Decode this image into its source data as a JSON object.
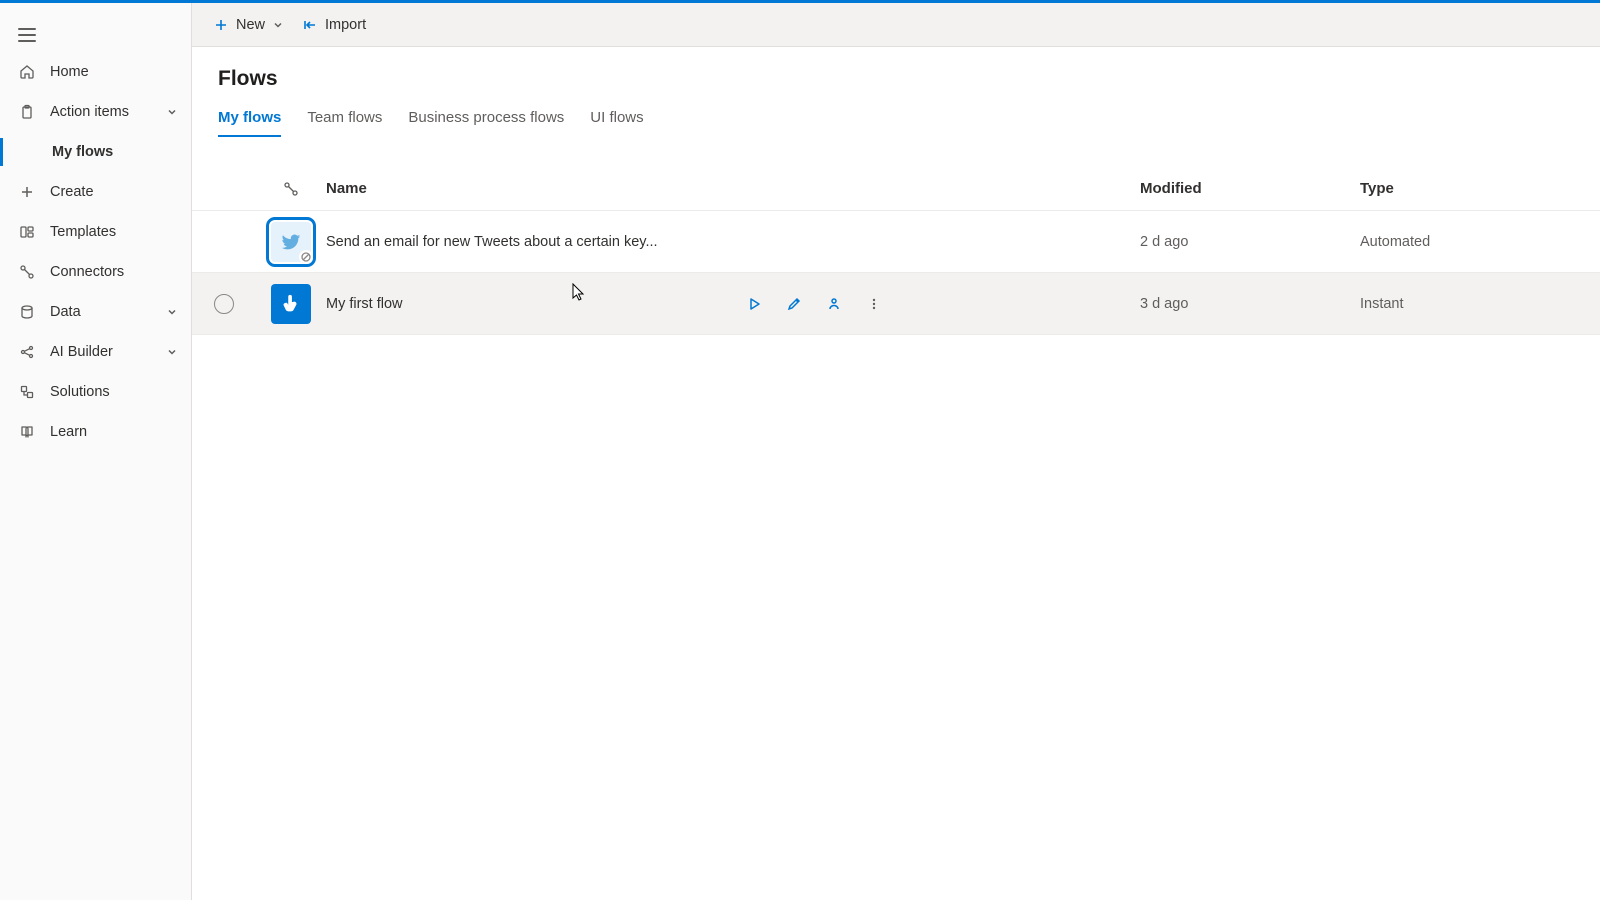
{
  "toolbar": {
    "new_label": "New",
    "import_label": "Import"
  },
  "sidebar": {
    "items": [
      {
        "label": "Home"
      },
      {
        "label": "Action items"
      },
      {
        "label": "My flows"
      },
      {
        "label": "Create"
      },
      {
        "label": "Templates"
      },
      {
        "label": "Connectors"
      },
      {
        "label": "Data"
      },
      {
        "label": "AI Builder"
      },
      {
        "label": "Solutions"
      },
      {
        "label": "Learn"
      }
    ]
  },
  "page": {
    "title": "Flows",
    "tabs": [
      "My flows",
      "Team flows",
      "Business process flows",
      "UI flows"
    ],
    "active_tab": 0
  },
  "table": {
    "columns": {
      "name": "Name",
      "modified": "Modified",
      "type": "Type"
    },
    "rows": [
      {
        "name": "Send an email for new Tweets about a certain key...",
        "modified": "2 d ago",
        "type": "Automated"
      },
      {
        "name": "My first flow",
        "modified": "3 d ago",
        "type": "Instant"
      }
    ]
  }
}
